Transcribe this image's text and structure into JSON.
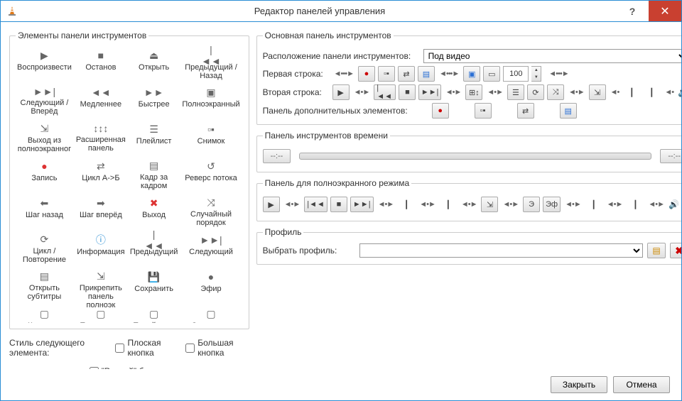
{
  "window": {
    "title": "Редактор панелей управления"
  },
  "left_panel": {
    "legend": "Элементы панели инструментов",
    "style_label": "Стиль следующего элемента:",
    "flat_button": "Плоская кнопка",
    "big_button": "Большая кнопка",
    "native_slider": "\"Родной\" бегунок",
    "items": [
      {
        "label": "Воспроизвести",
        "icon": "play"
      },
      {
        "label": "Останов",
        "icon": "stop"
      },
      {
        "label": "Открыть",
        "icon": "eject"
      },
      {
        "label": "Предыдущий / Назад",
        "icon": "prev"
      },
      {
        "label": "Следующий / Вперёд",
        "icon": "next"
      },
      {
        "label": "Медленнее",
        "icon": "slower"
      },
      {
        "label": "Быстрее",
        "icon": "faster"
      },
      {
        "label": "Полноэкранный",
        "icon": "fullscreen"
      },
      {
        "label": "Выход из полноэкранног",
        "icon": "exitfs"
      },
      {
        "label": "Расширенная панель",
        "icon": "sliders"
      },
      {
        "label": "Плейлист",
        "icon": "playlist"
      },
      {
        "label": "Снимок",
        "icon": "snapshot"
      },
      {
        "label": "Запись",
        "icon": "record"
      },
      {
        "label": "Цикл A->Б",
        "icon": "loopab"
      },
      {
        "label": "Кадр за кадром",
        "icon": "frame"
      },
      {
        "label": "Реверс потока",
        "icon": "reverse"
      },
      {
        "label": "Шаг назад",
        "icon": "stepback"
      },
      {
        "label": "Шаг вперёд",
        "icon": "stepfwd"
      },
      {
        "label": "Выход",
        "icon": "exit"
      },
      {
        "label": "Случайный порядок",
        "icon": "shuffle"
      },
      {
        "label": "Цикл / Повторение",
        "icon": "loop"
      },
      {
        "label": "Информация",
        "icon": "info"
      },
      {
        "label": "Предыдущий",
        "icon": "previtm"
      },
      {
        "label": "Следующий",
        "icon": "nextitm"
      },
      {
        "label": "Открыть субтитры",
        "icon": "opensub"
      },
      {
        "label": "Прикрепить панель полноэк",
        "icon": "dock"
      },
      {
        "label": "Сохранить",
        "icon": "save"
      },
      {
        "label": "Эфир",
        "icon": "live"
      },
      {
        "label": "Качество",
        "icon": "quality"
      },
      {
        "label": "Пропустить",
        "icon": "skip"
      },
      {
        "label": "Перейти на",
        "icon": "goto"
      },
      {
        "label": "Отключить",
        "icon": "disable"
      }
    ]
  },
  "right_panel": {
    "legend_main": "Основная панель инструментов",
    "label_position": "Расположение панели инструментов:",
    "position_value": "Под видео",
    "label_line1": "Первая строка:",
    "label_line2": "Вторая строка:",
    "num_value": "100",
    "legend_addl": "Панель дополнительных элементов:",
    "legend_time": "Панель инструментов времени",
    "time_left": "--:--",
    "time_right": "--:--",
    "legend_fs": "Панель для полноэкранного режима",
    "legend_profile": "Профиль",
    "label_profile": "Выбрать профиль:",
    "profile_value": ""
  },
  "footer": {
    "close": "Закрыть",
    "cancel": "Отмена"
  }
}
